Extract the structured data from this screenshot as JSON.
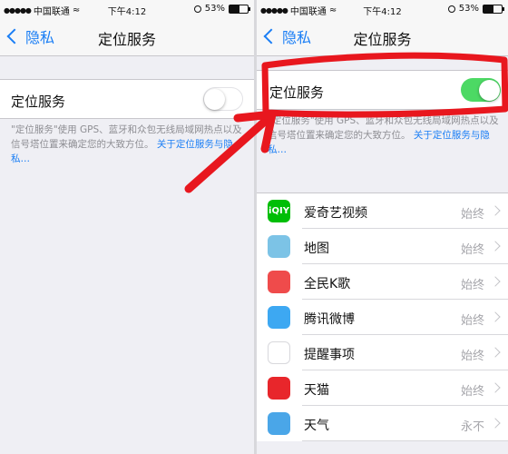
{
  "status_bar": {
    "carrier": "中国联通",
    "time": "下午4:12",
    "battery": "53%",
    "battery_level": 0.53
  },
  "nav": {
    "back_label": "隐私",
    "title": "定位服务"
  },
  "location": {
    "label": "定位服务",
    "description": "\"定位服务\"使用 GPS、蓝牙和众包无线局域网热点以及信号塔位置来确定您的大致方位。",
    "link": "关于定位服务与隐私…"
  },
  "left_toggle_on": false,
  "right_toggle_on": true,
  "apps": [
    {
      "name": "爱奇艺视频",
      "status": "始终",
      "icon": "iqiyi-icon",
      "color": "#00be06",
      "glyph": "iQIY"
    },
    {
      "name": "地图",
      "status": "始终",
      "icon": "maps-icon",
      "color": "#7cc3e6",
      "glyph": ""
    },
    {
      "name": "全民K歌",
      "status": "始终",
      "icon": "kge-icon",
      "color": "#ef4b4b",
      "glyph": ""
    },
    {
      "name": "腾讯微博",
      "status": "始终",
      "icon": "weibo-icon",
      "color": "#3da8f2",
      "glyph": ""
    },
    {
      "name": "提醒事项",
      "status": "始终",
      "icon": "reminders-icon",
      "color": "#ffffff",
      "glyph": ""
    },
    {
      "name": "天猫",
      "status": "始终",
      "icon": "tmall-icon",
      "color": "#e8262b",
      "glyph": ""
    },
    {
      "name": "天气",
      "status": "永不",
      "icon": "weather-icon",
      "color": "#4aa6e8",
      "glyph": ""
    }
  ],
  "colors": {
    "accent": "#1a7ef5",
    "toggle_on": "#4cd964",
    "annotation": "#e8171e"
  }
}
